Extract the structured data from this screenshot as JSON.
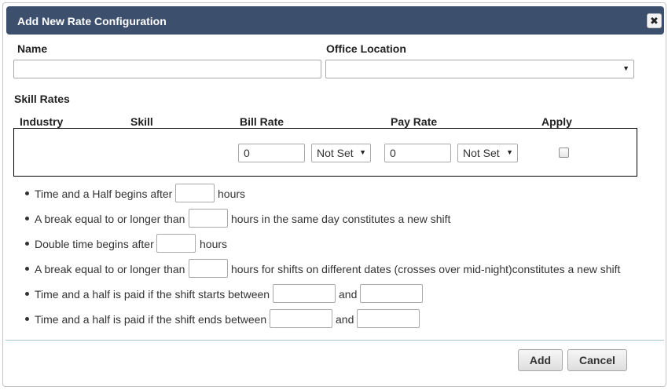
{
  "dialog": {
    "title": "Add New Rate Configuration",
    "close_icon": "close-icon"
  },
  "form": {
    "name_label": "Name",
    "name_value": "",
    "office_label": "Office Location",
    "office_value": "",
    "skill_rates_label": "Skill Rates"
  },
  "table": {
    "headers": [
      "Industry",
      "Skill",
      "Bill Rate",
      "Pay Rate",
      "Apply"
    ],
    "row": {
      "bill_rate": "0",
      "bill_unit": "Not Set",
      "pay_rate": "0",
      "pay_unit": "Not Set",
      "apply_checked": false
    }
  },
  "rules": [
    {
      "before": "Time and a Half begins after",
      "after": "hours"
    },
    {
      "before": "A break equal to or longer than",
      "after": "hours in the same day constitutes a new shift"
    },
    {
      "before": "Double time begins after",
      "after": "hours"
    },
    {
      "before": "A break equal to or longer than",
      "after": "hours for shifts on different dates (crosses over mid-night)constitutes a new shift"
    },
    {
      "before": "Time and a half is paid if the shift starts between",
      "middle": "and"
    },
    {
      "before": "Time and a half is paid if the shift ends between",
      "middle": "and"
    }
  ],
  "buttons": {
    "add": "Add",
    "cancel": "Cancel"
  },
  "icons": {
    "dropdown": "chevron-down-icon",
    "close": "close-icon"
  },
  "colors": {
    "titlebar": "#3c506e",
    "divider": "#a8c6d8"
  }
}
